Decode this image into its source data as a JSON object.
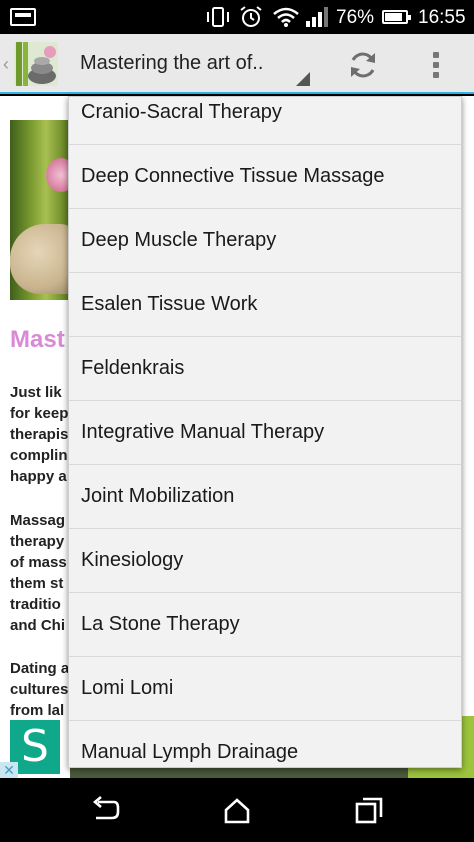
{
  "status_bar": {
    "battery_percent": "76%",
    "battery_level": 0.76,
    "time": "16:55"
  },
  "action_bar": {
    "spinner_title": "Mastering the art of..",
    "actions": [
      "refresh-icon",
      "overflow-menu-icon"
    ]
  },
  "article": {
    "title": "Mast",
    "paragraphs": [
      [
        "Just lik",
        "for keep",
        "therapis",
        "complin",
        "happy a"
      ],
      [
        "Massag",
        "therapy",
        "of mass",
        "them st",
        "traditio",
        "and Chi"
      ],
      [
        "Dating a",
        "cultures",
        "from lal"
      ]
    ]
  },
  "dropdown": {
    "items": [
      "Cranio-Sacral Therapy",
      "Deep Connective Tissue Massage",
      "Deep Muscle Therapy",
      "Esalen Tissue Work",
      "Feldenkrais",
      "Integrative Manual Therapy",
      "Joint Mobilization",
      "Kinesiology",
      "La Stone Therapy",
      "Lomi Lomi",
      "Manual Lymph Drainage"
    ]
  },
  "ad": {
    "logo_letter": "S",
    "close_label": "✕"
  },
  "nav_bar": {
    "buttons": [
      "back-icon",
      "home-icon",
      "recents-icon"
    ]
  },
  "colors": {
    "accent": "#33b5e5",
    "title_pink": "#d98ad6",
    "ad_green": "#0fa88b"
  }
}
